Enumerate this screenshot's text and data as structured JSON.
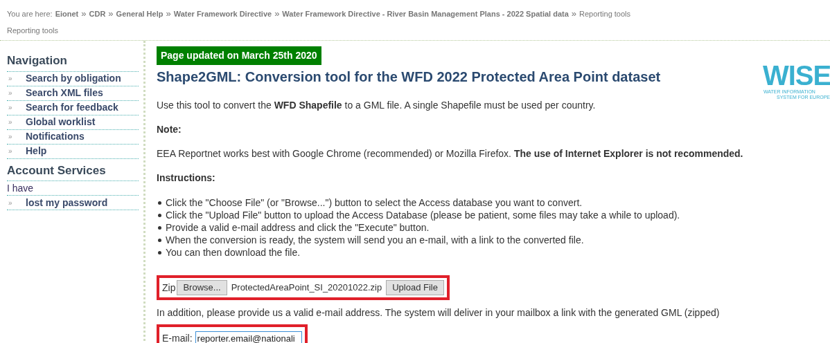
{
  "breadcrumb": {
    "prefix": "You are here:",
    "separator": "»",
    "items": [
      {
        "label": "Eionet",
        "kind": "link"
      },
      {
        "label": "CDR",
        "kind": "link"
      },
      {
        "label": "General Help",
        "kind": "link"
      },
      {
        "label": "Water Framework Directive",
        "kind": "link"
      },
      {
        "label": "Water Framework Directive - River Basin Management Plans - 2022 Spatial data",
        "kind": "link"
      },
      {
        "label": "Reporting tools",
        "kind": "current"
      }
    ],
    "page_label": "Reporting tools"
  },
  "sidebar": {
    "bullet": "»",
    "sections": [
      {
        "title": "Navigation",
        "items": [
          {
            "label": "Search by obligation",
            "kind": "link"
          },
          {
            "label": "Search XML files",
            "kind": "link"
          },
          {
            "label": "Search for feedback",
            "kind": "link"
          },
          {
            "label": "Global worklist",
            "kind": "link"
          },
          {
            "label": "Notifications",
            "kind": "link"
          },
          {
            "label": "Help",
            "kind": "link"
          }
        ]
      },
      {
        "title": "Account Services",
        "items": [
          {
            "label": "I have",
            "kind": "text"
          },
          {
            "label": "lost my password",
            "kind": "link"
          }
        ]
      }
    ]
  },
  "main": {
    "updated_badge": "Page updated on March 25th 2020",
    "title": "Shape2GML: Conversion tool for the WFD 2022 Protected Area Point dataset",
    "logo": {
      "word": "WISE",
      "line_1": "WATER INFORMATION",
      "line_2": "SYSTEM FOR EUROPE"
    },
    "intro": "Use this tool to convert the **WFD Shapefile** to a GML file. A single Shapefile must be used per country.",
    "note_heading": "Note:",
    "note": "EEA Reportnet works best with Google Chrome (recommended) or Mozilla Firefox. **The use of Internet Explorer is not recommended.**",
    "instructions_heading": "Instructions:",
    "instructions": [
      "Click the \"Choose File\" (or \"Browse...\") button to select the Access database you want to convert.",
      "Click the \"Upload File\" button to upload the Access Database (please be patient, some files may take a while to upload).",
      "Provide a valid e-mail address and click the \"Execute\" button.",
      "When the conversion is ready, the system will send you an e-mail, with a link to the converted file.",
      "You can then download the file."
    ],
    "upload": {
      "label": "Zip",
      "browse_button": "Browse...",
      "file_name": "ProtectedAreaPoint_SI_20201022.zip",
      "upload_button": "Upload File"
    },
    "email_note": "In addition, please provide us a valid e-mail address. The system will deliver in your mailbox a link with the generated GML (zipped)",
    "email": {
      "label": "E-mail:",
      "value": "reporter.email@nationali"
    }
  }
}
